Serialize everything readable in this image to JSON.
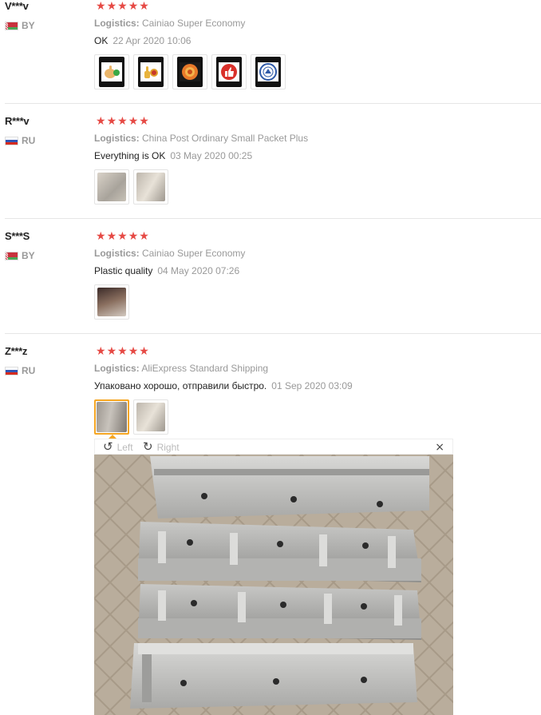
{
  "reviews": [
    {
      "user": "V***v",
      "country": "BY",
      "stars": 5,
      "logistics_label": "Logistics:",
      "logistics_value": "Cainiao Super Economy",
      "feedback": "OK",
      "date": "22 Apr 2020 10:06",
      "thumbs": [
        "thumbs-up-coin-sticker",
        "thumbs-up-coin-sticker",
        "orange-badge-sticker",
        "red-like-sticker",
        "blue-seal-sticker"
      ]
    },
    {
      "user": "R***v",
      "country": "RU",
      "stars": 5,
      "logistics_label": "Logistics:",
      "logistics_value": "China Post Ordinary Small Packet Plus",
      "feedback": "Everything is OK",
      "date": "03 May 2020 00:25",
      "thumbs": [
        "product-photo",
        "product-photo"
      ]
    },
    {
      "user": "S***S",
      "country": "BY",
      "stars": 5,
      "logistics_label": "Logistics:",
      "logistics_value": "Cainiao Super Economy",
      "feedback": "Plastic quality",
      "date": "04 May 2020 07:26",
      "thumbs": [
        "product-photo"
      ]
    },
    {
      "user": "Z***z",
      "country": "RU",
      "stars": 5,
      "logistics_label": "Logistics:",
      "logistics_value": "AliExpress Standard Shipping",
      "feedback": "Упаковано хорошо, отправили быстро.",
      "date": "01 Sep 2020 03:09",
      "thumbs": [
        "product-photo",
        "product-photo"
      ]
    }
  ],
  "viewer": {
    "rotate_left_label": "Left",
    "rotate_right_label": "Right",
    "close_symbol": "×"
  },
  "colors": {
    "star": "#e64a45",
    "selected_thumb_border": "#f5a623",
    "muted_text": "#999999"
  }
}
